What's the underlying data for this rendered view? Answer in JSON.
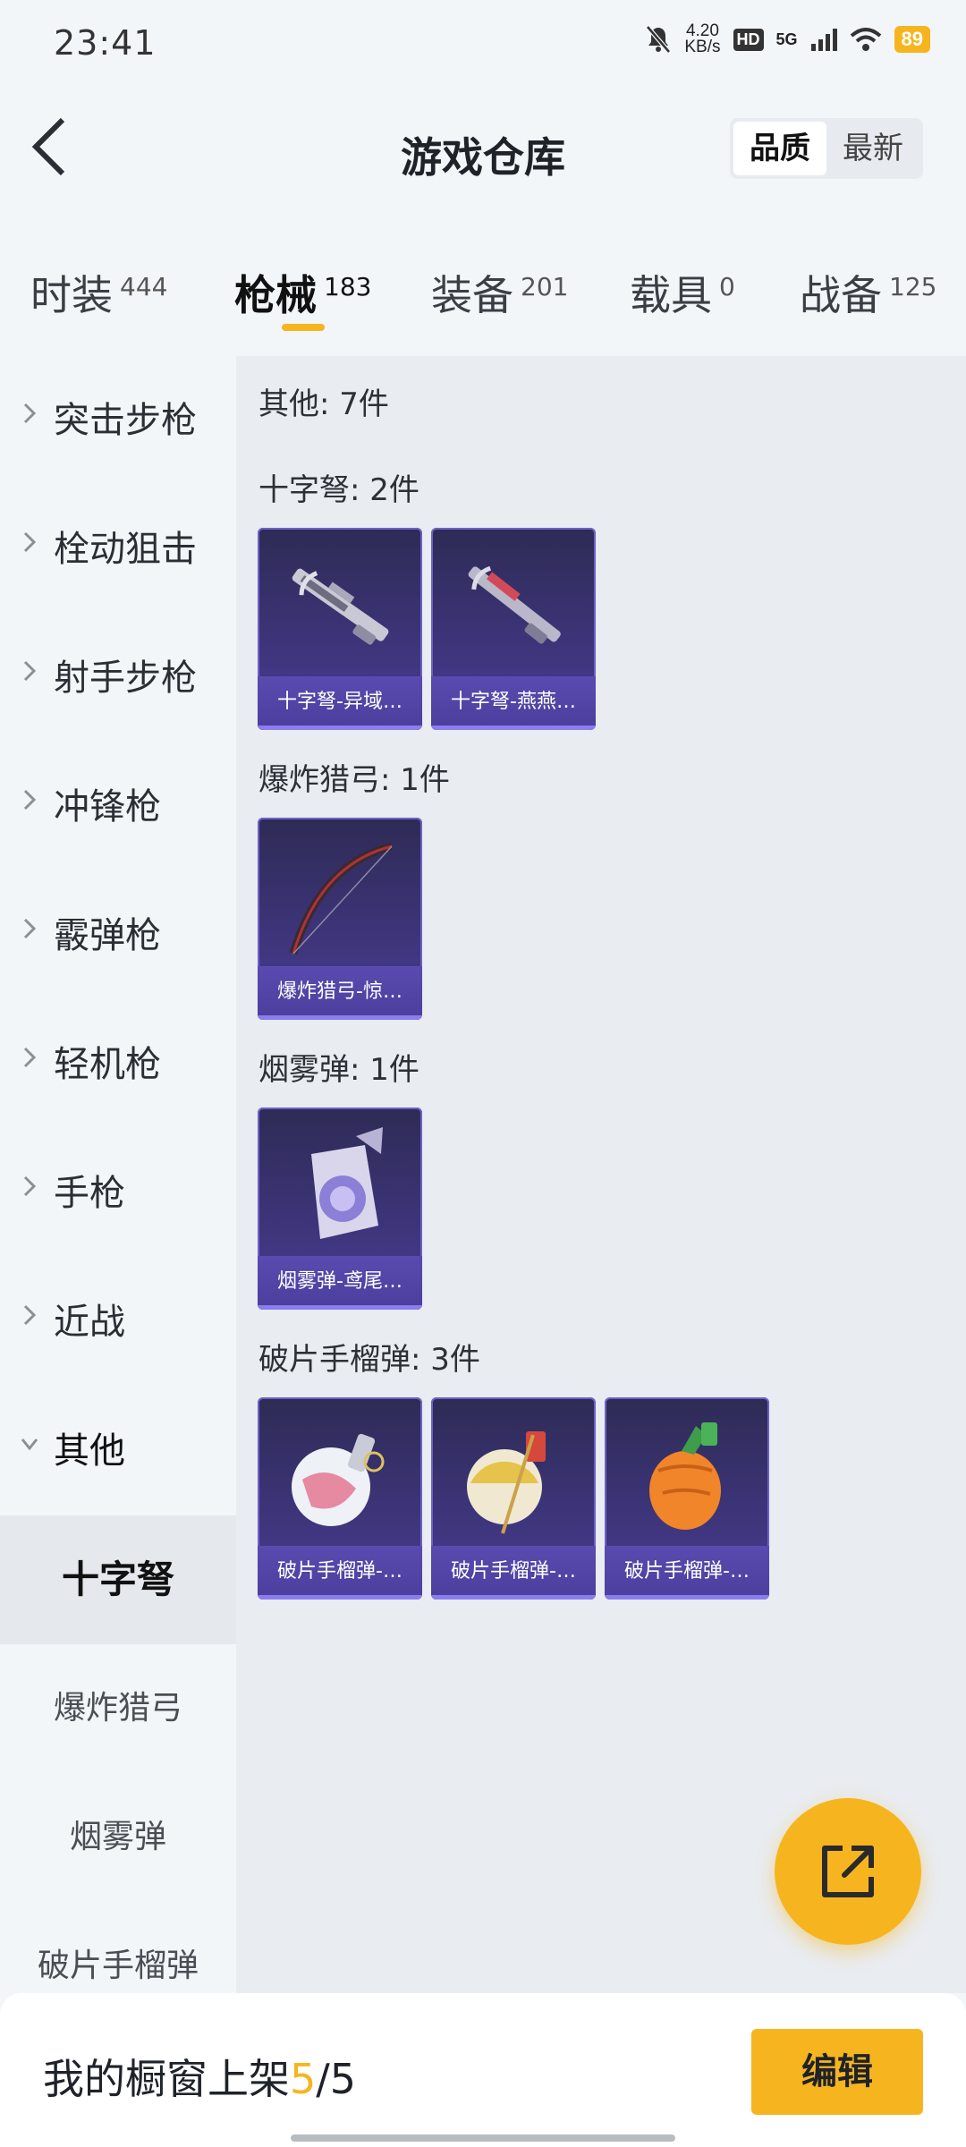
{
  "status": {
    "time": "23:41",
    "speed_top": "4.20",
    "speed_unit": "KB/s",
    "hd": "HD",
    "network": "5G",
    "battery": "89"
  },
  "header": {
    "title": "游戏仓库",
    "sort_options": [
      "品质",
      "最新"
    ],
    "sort_selected": "品质"
  },
  "tabs": [
    {
      "label": "时装",
      "count": "444"
    },
    {
      "label": "枪械",
      "count": "183",
      "active": true
    },
    {
      "label": "装备",
      "count": "201"
    },
    {
      "label": "载具",
      "count": "0"
    },
    {
      "label": "战备",
      "count": "125"
    }
  ],
  "side_menu": {
    "categories": [
      "突击步枪",
      "栓动狙击",
      "射手步枪",
      "冲锋枪",
      "霰弹枪",
      "轻机枪",
      "手枪",
      "近战",
      "其他"
    ],
    "expanded": "其他",
    "sub_items": [
      "十字弩",
      "爆炸猎弓",
      "烟雾弹",
      "破片手榴弹"
    ],
    "selected_sub": "十字弩"
  },
  "content": {
    "summary": "其他: 7件",
    "groups": [
      {
        "title": "十字弩: 2件",
        "items": [
          {
            "caption": "十字弩-异域…",
            "icon": "crossbow-icon"
          },
          {
            "caption": "十字弩-燕燕…",
            "icon": "crossbow-icon"
          }
        ]
      },
      {
        "title": "爆炸猎弓: 1件",
        "items": [
          {
            "caption": "爆炸猎弓-惊…",
            "icon": "bow-icon"
          }
        ]
      },
      {
        "title": "烟雾弹: 1件",
        "items": [
          {
            "caption": "烟雾弹-鸢尾…",
            "icon": "smoke-grenade-icon"
          }
        ]
      },
      {
        "title": "破片手榴弹: 3件",
        "items": [
          {
            "caption": "破片手榴弹-…",
            "icon": "grenade-icon"
          },
          {
            "caption": "破片手榴弹-…",
            "icon": "grenade-icon"
          },
          {
            "caption": "破片手榴弹-…",
            "icon": "grenade-icon"
          }
        ]
      }
    ]
  },
  "bottom": {
    "shelf_label": "我的橱窗上架",
    "shelf_current": "5",
    "shelf_sep": "/",
    "shelf_total": "5",
    "edit_label": "编辑"
  },
  "colors": {
    "accent": "#f6b51e",
    "card_bg": "#3c3478",
    "background": "#f3f6f9"
  }
}
